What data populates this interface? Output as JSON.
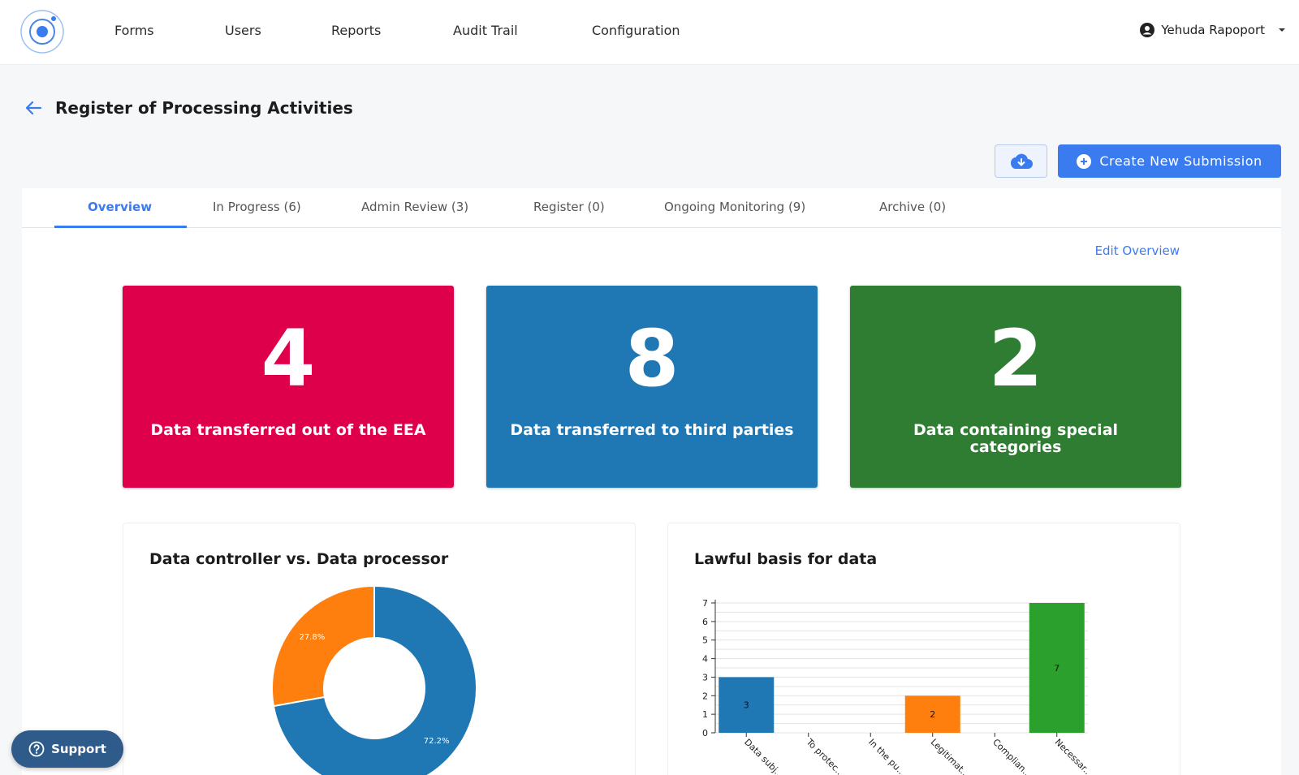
{
  "nav": {
    "items": [
      {
        "label": "Forms"
      },
      {
        "label": "Users"
      },
      {
        "label": "Reports"
      },
      {
        "label": "Audit Trail"
      },
      {
        "label": "Configuration"
      }
    ],
    "user_name": "Yehuda Rapoport"
  },
  "page": {
    "title": "Register of Processing Activities",
    "create_button": "Create New Submission",
    "edit_overview": "Edit Overview"
  },
  "tabs": [
    {
      "label": "Overview",
      "active": true
    },
    {
      "label": "In Progress (6)"
    },
    {
      "label": "Admin Review (3)"
    },
    {
      "label": "Register (0)"
    },
    {
      "label": "Ongoing Monitoring (9)"
    },
    {
      "label": "Archive (0)"
    }
  ],
  "stats": [
    {
      "value": "4",
      "label": "Data transferred out of the EEA",
      "color": "#df004c"
    },
    {
      "value": "8",
      "label": "Data transferred to third parties",
      "color": "#1f77b4"
    },
    {
      "value": "2",
      "label": "Data containing special categories",
      "color": "#2e7d32"
    }
  ],
  "charts": {
    "donut_title": "Data controller vs. Data processor",
    "bar_title": "Lawful basis for data"
  },
  "chart_data": [
    {
      "type": "pie",
      "title": "Data controller vs. Data processor",
      "slices": [
        {
          "value": 72.2,
          "label": "72.2%",
          "color": "#1f77b4"
        },
        {
          "value": 27.8,
          "label": "27.8%",
          "color": "#ff7f0e"
        }
      ]
    },
    {
      "type": "bar",
      "title": "Lawful basis for data",
      "categories": [
        "Data subj...",
        "To protec...",
        "In the pu...",
        "Legitimat...",
        "Complian...",
        "Necessar..."
      ],
      "values": [
        3,
        0,
        0,
        2,
        0,
        7
      ],
      "colors": [
        "#1f77b4",
        "#1f77b4",
        "#1f77b4",
        "#ff7f0e",
        "#1f77b4",
        "#2ca02c"
      ],
      "ylim": [
        0,
        7
      ],
      "yticks": [
        0,
        1,
        2,
        3,
        4,
        5,
        6,
        7
      ],
      "grid": true
    }
  ],
  "support": {
    "label": "Support"
  }
}
